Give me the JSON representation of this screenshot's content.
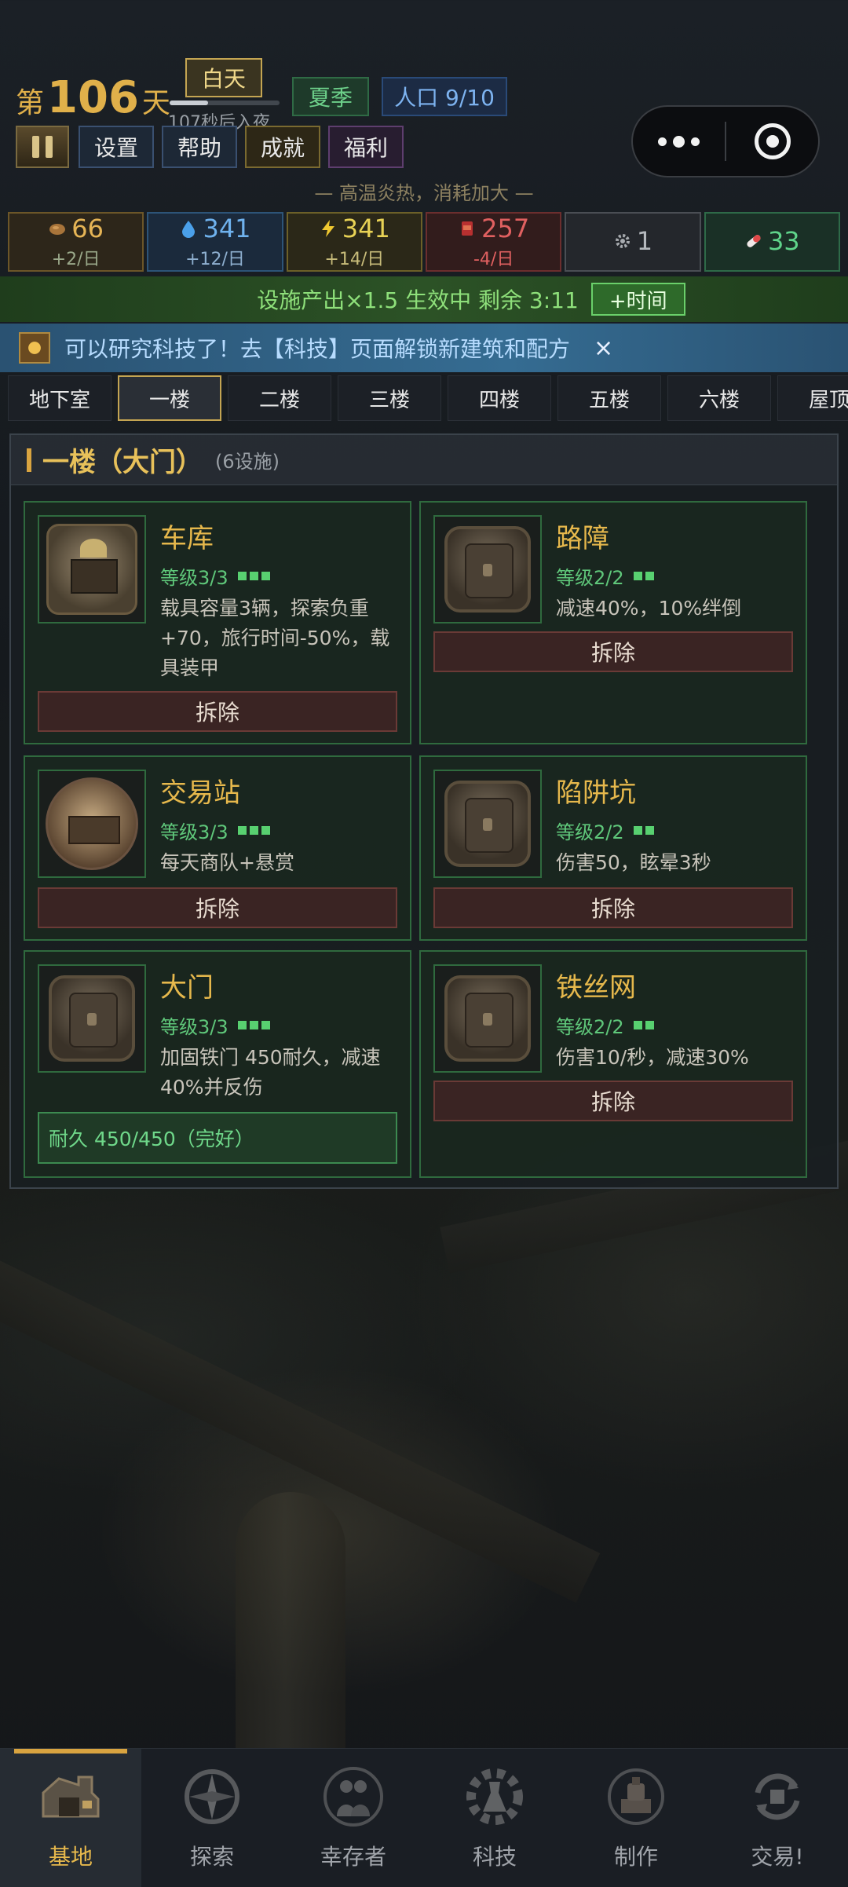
{
  "header": {
    "day_prefix": "第",
    "day_number": "106",
    "day_suffix": "天",
    "daytime": "白天",
    "night_countdown": "107秒后入夜",
    "day_progress_percent": 35,
    "season": "夏季",
    "population": "人口 9/10",
    "buttons": {
      "settings": "设置",
      "help": "帮助",
      "achievements": "成就",
      "welfare": "福利"
    },
    "weather_note": "— 高温炎热，消耗加大 —"
  },
  "resources": [
    {
      "value": "66",
      "rate": "+2/日",
      "icon": "food-icon"
    },
    {
      "value": "341",
      "rate": "+12/日",
      "icon": "water-drop-icon"
    },
    {
      "value": "341",
      "rate": "+14/日",
      "icon": "lightning-icon"
    },
    {
      "value": "257",
      "rate": "-4/日",
      "icon": "meat-can-icon"
    },
    {
      "value": "1",
      "rate": "",
      "icon": "gear-icon"
    },
    {
      "value": "33",
      "rate": "",
      "icon": "pill-icon"
    }
  ],
  "boost": {
    "text": "设施产出×1.5 生效中  剩余 3:11",
    "button": "+时间"
  },
  "notice": {
    "text": "可以研究科技了！去【科技】页面解锁新建筑和配方",
    "close": "×"
  },
  "floors": [
    "地下室",
    "一楼",
    "二楼",
    "三楼",
    "四楼",
    "五楼",
    "六楼",
    "屋顶"
  ],
  "active_floor": "一楼",
  "panel": {
    "title": "一楼（大门）",
    "count": "(6设施)"
  },
  "facilities": [
    {
      "name": "车库",
      "level": "等级3/3",
      "pips": 3,
      "desc": "载具容量3辆，探索负重+70，旅行时间-50%，载具装甲",
      "action": "拆除",
      "icon": "garage-icon"
    },
    {
      "name": "路障",
      "level": "等级2/2",
      "pips": 2,
      "desc": "减速40%，10%绊倒",
      "action": "拆除",
      "icon": "iron-door-icon"
    },
    {
      "name": "交易站",
      "level": "等级3/3",
      "pips": 3,
      "desc": "每天商队+悬赏",
      "action": "拆除",
      "icon": "trading-post-icon"
    },
    {
      "name": "陷阱坑",
      "level": "等级2/2",
      "pips": 2,
      "desc": "伤害50，眩晕3秒",
      "action": "拆除",
      "icon": "iron-door-icon"
    },
    {
      "name": "大门",
      "level": "等级3/3",
      "pips": 3,
      "desc": "加固铁门 450耐久，减速40%并反伤",
      "durability": "耐久 450/450（完好）",
      "icon": "iron-door-icon"
    },
    {
      "name": "铁丝网",
      "level": "等级2/2",
      "pips": 2,
      "desc": "伤害10/秒，减速30%",
      "action": "拆除",
      "icon": "iron-door-icon"
    }
  ],
  "bottom_nav": [
    {
      "label": "基地",
      "icon": "base-icon",
      "active": true
    },
    {
      "label": "探索",
      "icon": "compass-icon"
    },
    {
      "label": "幸存者",
      "icon": "survivors-icon"
    },
    {
      "label": "科技",
      "icon": "tech-gear-icon"
    },
    {
      "label": "制作",
      "icon": "crafting-icon"
    },
    {
      "label": "交易!",
      "icon": "trade-cycle-icon"
    }
  ]
}
